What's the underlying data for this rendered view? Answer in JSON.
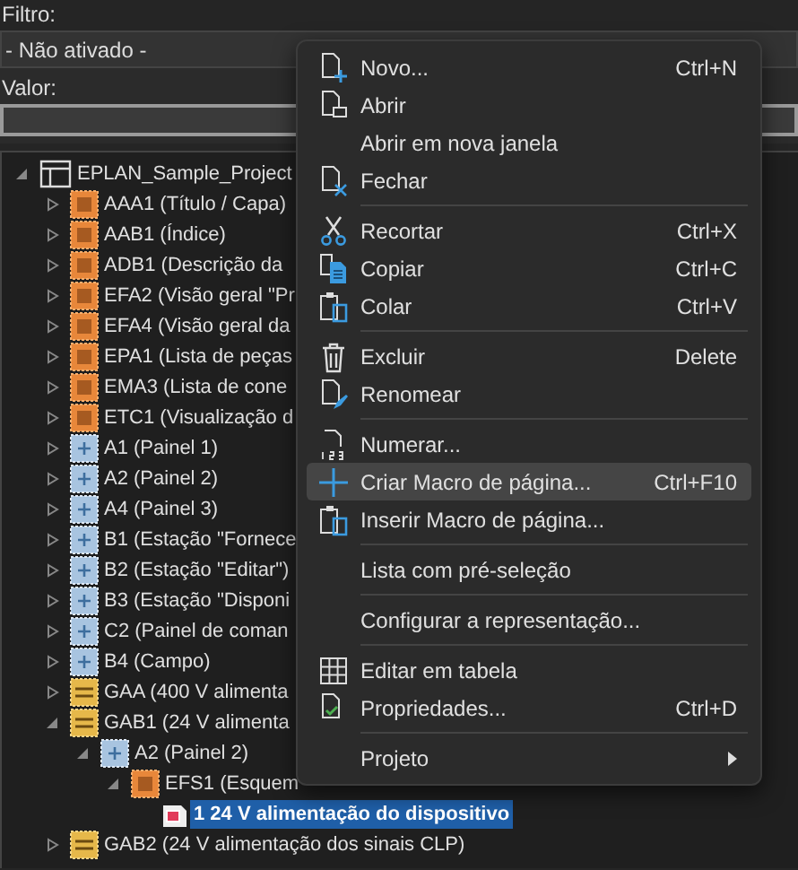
{
  "filter": {
    "label": "Filtro:",
    "value": "- Não ativado -"
  },
  "value_field": {
    "label": "Valor:"
  },
  "tree": {
    "label": "EPLAN_Sample_Project",
    "kind": "project",
    "expanded": true,
    "selected": false,
    "children": [
      {
        "label": "AAA1 (Título / Capa)",
        "kind": "document",
        "expanded": false,
        "selected": false
      },
      {
        "label": "AAB1 (Índice)",
        "kind": "document",
        "expanded": false,
        "selected": false
      },
      {
        "label": "ADB1 (Descrição da",
        "kind": "document",
        "expanded": false,
        "selected": false
      },
      {
        "label": "EFA2 (Visão geral \"Pr",
        "kind": "document",
        "expanded": false,
        "selected": false
      },
      {
        "label": "EFA4 (Visão geral da",
        "kind": "document",
        "expanded": false,
        "selected": false
      },
      {
        "label": "EPA1 (Lista de peças",
        "kind": "document",
        "expanded": false,
        "selected": false
      },
      {
        "label": "EMA3 (Lista de cone",
        "kind": "document",
        "expanded": false,
        "selected": false
      },
      {
        "label": "ETC1 (Visualização d",
        "kind": "document",
        "expanded": false,
        "selected": false
      },
      {
        "label": "A1 (Painel 1)",
        "kind": "panel",
        "expanded": false,
        "selected": false
      },
      {
        "label": "A2 (Painel 2)",
        "kind": "panel",
        "expanded": false,
        "selected": false
      },
      {
        "label": "A4 (Painel 3)",
        "kind": "panel",
        "expanded": false,
        "selected": false
      },
      {
        "label": "B1 (Estação \"Fornece",
        "kind": "panel",
        "expanded": false,
        "selected": false
      },
      {
        "label": "B2 (Estação \"Editar\")",
        "kind": "panel",
        "expanded": false,
        "selected": false
      },
      {
        "label": "B3 (Estação \"Disponi",
        "kind": "panel",
        "expanded": false,
        "selected": false
      },
      {
        "label": "C2 (Painel de coman",
        "kind": "panel",
        "expanded": false,
        "selected": false
      },
      {
        "label": "B4 (Campo)",
        "kind": "panel",
        "expanded": false,
        "selected": false
      },
      {
        "label": "GAA (400 V alimenta",
        "kind": "function",
        "expanded": false,
        "selected": false
      },
      {
        "label": "GAB1 (24 V alimenta",
        "kind": "function",
        "expanded": true,
        "selected": false,
        "children": [
          {
            "label": "A2 (Painel 2)",
            "kind": "panel",
            "expanded": true,
            "selected": false,
            "children": [
              {
                "label": "EFS1 (Esquem",
                "kind": "document",
                "expanded": true,
                "selected": false,
                "children": [
                  {
                    "label": "1 24 V alimentação do dispositivo",
                    "kind": "page",
                    "selected": true
                  }
                ]
              }
            ]
          }
        ]
      },
      {
        "label": "GAB2 (24 V alimentação dos sinais CLP)",
        "kind": "function",
        "expanded": false,
        "selected": false
      }
    ]
  },
  "context_menu": {
    "groups": [
      [
        {
          "label": "Novo...",
          "shortcut": "Ctrl+N",
          "selected": false
        },
        {
          "label": "Abrir",
          "selected": false
        },
        {
          "label": "Abrir em nova janela",
          "selected": false
        },
        {
          "label": "Fechar",
          "selected": false
        }
      ],
      [
        {
          "label": "Recortar",
          "shortcut": "Ctrl+X",
          "selected": false
        },
        {
          "label": "Copiar",
          "shortcut": "Ctrl+C",
          "selected": false
        },
        {
          "label": "Colar",
          "shortcut": "Ctrl+V",
          "selected": false
        }
      ],
      [
        {
          "label": "Excluir",
          "shortcut": "Delete",
          "selected": false
        },
        {
          "label": "Renomear",
          "selected": false
        }
      ],
      [
        {
          "label": "Numerar...",
          "selected": false
        },
        {
          "label": "Criar Macro de página...",
          "shortcut": "Ctrl+F10",
          "selected": true
        },
        {
          "label": "Inserir Macro de página...",
          "selected": false
        }
      ],
      [
        {
          "label": "Lista com pré-seleção",
          "selected": false
        }
      ],
      [
        {
          "label": "Configurar a representação...",
          "selected": false
        }
      ],
      [
        {
          "label": "Editar em tabela",
          "selected": false
        },
        {
          "label": "Propriedades...",
          "shortcut": "Ctrl+D",
          "selected": false
        }
      ],
      [
        {
          "label": "Projeto",
          "submenu": true,
          "selected": false
        }
      ]
    ]
  }
}
